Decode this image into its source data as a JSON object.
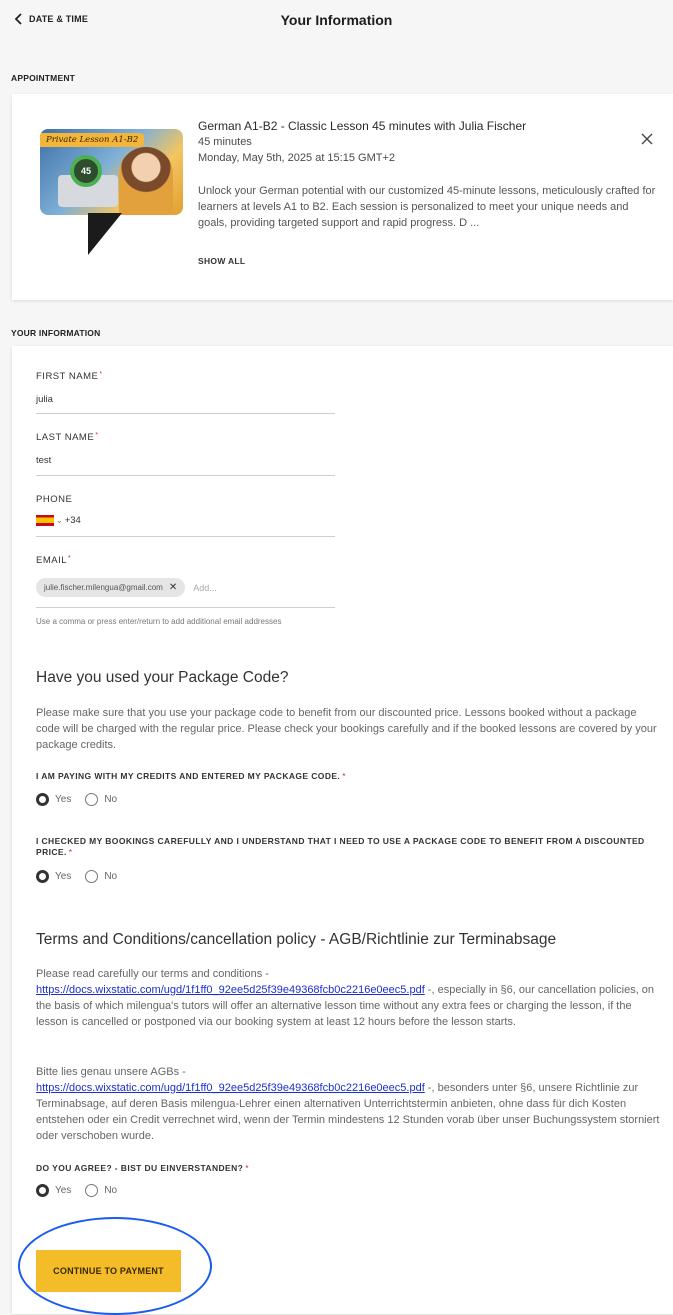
{
  "header": {
    "back_label": "DATE & TIME",
    "title": "Your Information"
  },
  "appointment": {
    "section_label": "APPOINTMENT",
    "thumbnail_badge": "Private Lesson A1-B2",
    "thumbnail_timer": "45",
    "title": "German A1-B2 - Classic Lesson 45 minutes with Julia Fischer",
    "duration": "45 minutes",
    "date": "Monday, May 5th, 2025 at 15:15 GMT+2",
    "description": "Unlock your German potential with our customized 45-minute lessons, meticulously crafted for learners at levels A1 to B2. Each session is personalized to meet your unique needs and goals, providing targeted support and rapid progress. D ...",
    "show_all_label": "SHOW ALL"
  },
  "info": {
    "section_label": "YOUR INFORMATION",
    "first_name": {
      "label": "FIRST NAME",
      "required": "*",
      "value": "julia"
    },
    "last_name": {
      "label": "LAST NAME",
      "required": "*",
      "value": "test"
    },
    "phone": {
      "label": "PHONE",
      "country_code": "+34",
      "flag": "spain-flag-icon"
    },
    "email": {
      "label": "EMAIL",
      "required": "*",
      "chip": "julie.fischer.milengua@gmail.com",
      "placeholder": "Add...",
      "hint": "Use a comma or press enter/return to add additional email addresses"
    }
  },
  "package": {
    "heading": "Have you used your Package Code?",
    "text": "Please make sure that you use your package code to benefit from our discounted price. Lessons booked without a package code will be charged with the regular price. Please check your bookings carefully and if the booked lessons are covered by your package credits.",
    "q1": {
      "label": "I AM PAYING WITH MY CREDITS AND ENTERED MY PACKAGE CODE.",
      "required": "*",
      "yes": "Yes",
      "no": "No",
      "selected": "yes"
    },
    "q2": {
      "label": "I CHECKED MY BOOKINGS CAREFULLY AND I UNDERSTAND THAT I NEED TO USE A PACKAGE CODE TO BENEFIT FROM A DISCOUNTED PRICE.",
      "required": "*",
      "yes": "Yes",
      "no": "No",
      "selected": "yes"
    }
  },
  "terms": {
    "heading": "Terms and Conditions/cancellation policy - AGB/Richtlinie zur Terminabsage",
    "en_intro": "Please read carefully our terms and conditions -",
    "link": "https://docs.wixstatic.com/ugd/1f1ff0_92ee5d25f39e49368fcb0c2216e0eec5.pdf",
    "en_rest": " -, especially in §6, our cancellation policies, on the basis of which milengua's tutors will offer an alternative lesson time without any extra fees or charging the lesson, if the lesson is cancelled or postponed via our booking system at least 12 hours before the lesson starts.",
    "de_intro": "Bitte lies genau unsere AGBs -",
    "de_rest": " -, besonders unter §6, unsere Richtlinie zur Terminabsage, auf deren Basis milengua-Lehrer einen alternativen Unterrichtstermin anbieten, ohne dass für dich Kosten entstehen oder ein Credit verrechnet wird, wenn der Termin mindestens 12 Stunden vorab über unser Buchungssystem storniert oder verschoben wurde.",
    "q": {
      "label": "DO YOU AGREE? - BIST DU EINVERSTANDEN?",
      "required": "*",
      "yes": "Yes",
      "no": "No",
      "selected": "yes"
    }
  },
  "footer": {
    "continue_label": "CONTINUE TO PAYMENT"
  },
  "colors": {
    "accent": "#f5bc2a",
    "link": "#1b2fd0",
    "highlight_ring": "#1a5cf0",
    "required": "#cc3333"
  }
}
